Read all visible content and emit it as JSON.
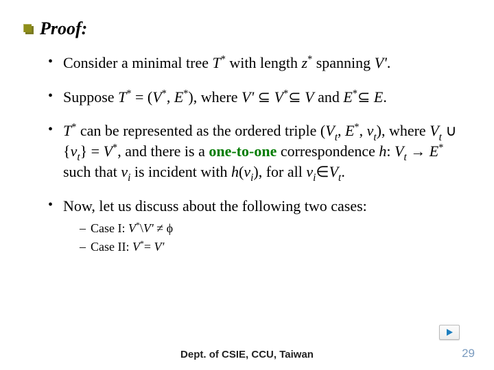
{
  "title": "Proof:",
  "items": [
    {
      "parts": [
        "Consider a minimal tree ",
        {
          "it": "T"
        },
        {
          "sup": "*"
        },
        " with length ",
        {
          "it": "z"
        },
        {
          "sup": "*"
        },
        " spanning ",
        {
          "it": "V"
        },
        {
          "it": "'"
        },
        "."
      ]
    },
    {
      "parts": [
        "Suppose ",
        {
          "it": "T"
        },
        {
          "sup": "*"
        },
        " = (",
        {
          "it": "V"
        },
        {
          "sup": "*"
        },
        ", ",
        {
          "it": "E"
        },
        {
          "sup": "*"
        },
        "), where ",
        {
          "it": "V"
        },
        {
          "it": "'"
        },
        " ",
        {
          "sym": "⊆"
        },
        " ",
        {
          "it": "V"
        },
        {
          "sup": "*"
        },
        {
          "sym": "⊆"
        },
        " ",
        {
          "it": "V"
        },
        " and ",
        {
          "it": "E"
        },
        {
          "sup": "*"
        },
        {
          "sym": "⊆"
        },
        " ",
        {
          "it": "E"
        },
        "."
      ]
    },
    {
      "parts": [
        {
          "it": "T"
        },
        {
          "sup": "*"
        },
        " can be represented as the ordered triple (",
        {
          "it": "V"
        },
        {
          "sub": "t"
        },
        ", ",
        {
          "it": "E"
        },
        {
          "sup": "*"
        },
        ", ",
        {
          "it": "v"
        },
        {
          "sub": "t"
        },
        "), where ",
        {
          "it": "V"
        },
        {
          "sub": "t"
        },
        " ",
        {
          "sym": "∪"
        },
        " {",
        {
          "it": "v"
        },
        {
          "sub": "t"
        },
        "} = ",
        {
          "it": "V"
        },
        {
          "sup": "*"
        },
        ", and there is a ",
        {
          "bold_green": "one-to-one"
        },
        " correspondence ",
        {
          "it": "h"
        },
        ": ",
        {
          "it": "V"
        },
        {
          "sub": "t"
        },
        " → ",
        {
          "it": "E"
        },
        {
          "sup": "*"
        },
        " such that ",
        {
          "it": "v"
        },
        {
          "sub": "i"
        },
        " is incident with ",
        {
          "it": "h"
        },
        "(",
        {
          "it": "v"
        },
        {
          "sub": "i"
        },
        "), for all ",
        {
          "it": "v"
        },
        {
          "sub": "i"
        },
        {
          "sym": "∈"
        },
        {
          "it": "V"
        },
        {
          "sub": "t"
        },
        "."
      ]
    },
    {
      "parts": [
        "Now, let us discuss about the following two cases:"
      ],
      "sub": [
        {
          "parts": [
            "Case I: ",
            {
              "it": "V"
            },
            {
              "sup": "*"
            },
            "\\",
            {
              "it": "V"
            },
            {
              "it": "'"
            },
            " ",
            {
              "sym": "≠"
            },
            " ",
            {
              "sym": "ϕ"
            }
          ]
        },
        {
          "parts": [
            "Case II: ",
            {
              "it": "V"
            },
            {
              "sup": "*"
            },
            "= ",
            {
              "it": "V"
            },
            {
              "it": "'"
            }
          ]
        }
      ]
    }
  ],
  "footer": "Dept. of CSIE, CCU, Taiwan",
  "page_number": "29",
  "nav_play_color": "#1e7fbf"
}
